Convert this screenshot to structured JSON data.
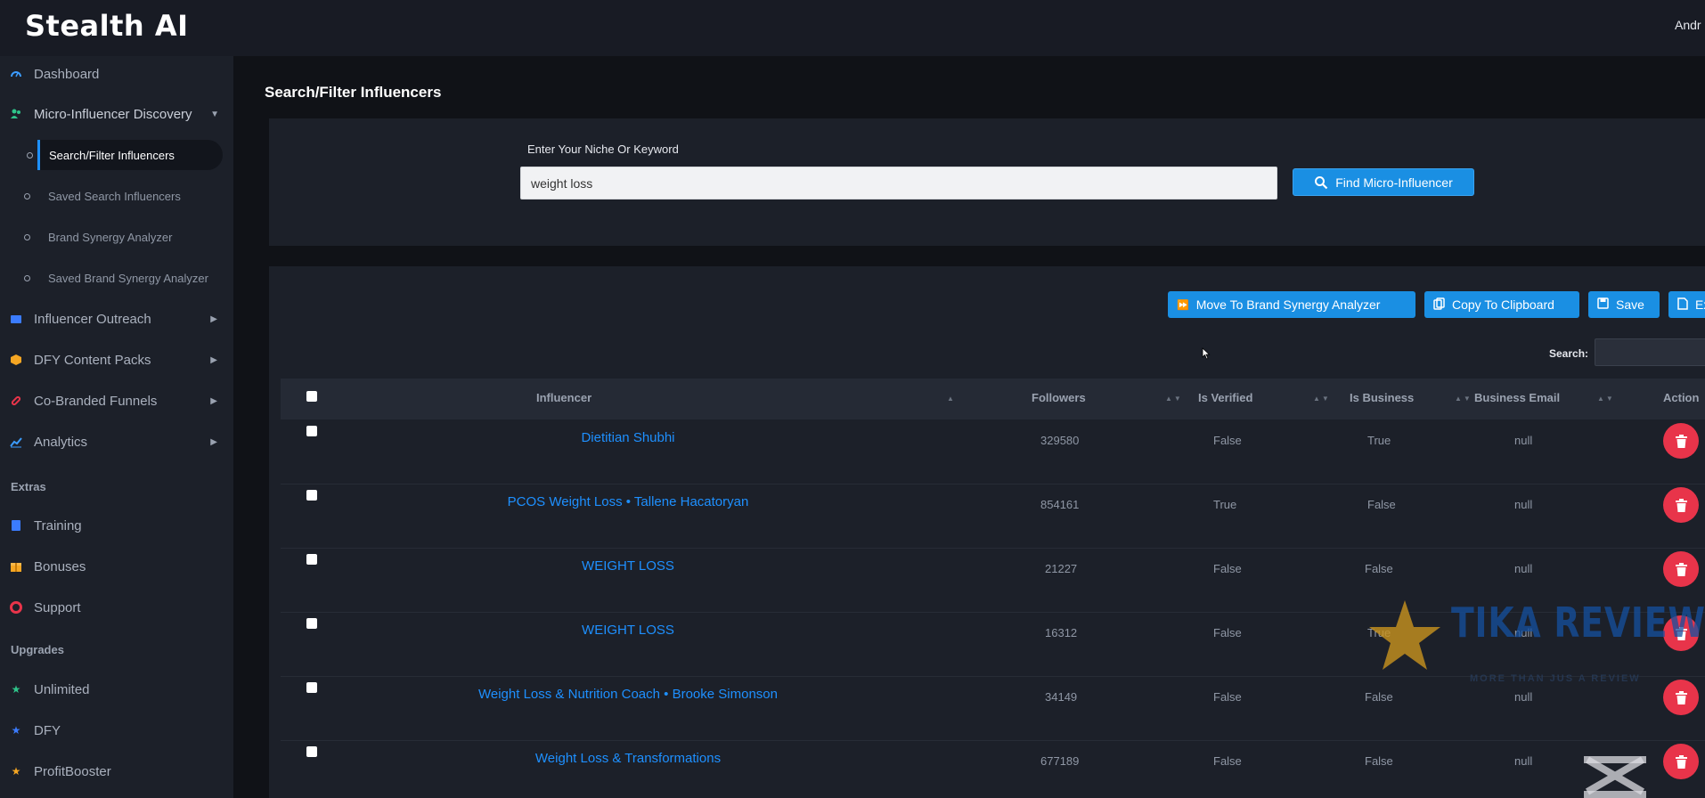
{
  "app": {
    "logo": "Stealth AI",
    "user": "Andr"
  },
  "colors": {
    "accent": "#1a8fe3",
    "danger": "#e8344a",
    "link": "#1e90ff"
  },
  "sidebar": {
    "items": [
      {
        "label": "Dashboard",
        "icon": "dashboard-icon"
      },
      {
        "label": "Micro-Influencer Discovery",
        "icon": "people-icon"
      },
      {
        "label": "Influencer Outreach",
        "icon": "envelope-icon"
      },
      {
        "label": "DFY Content Packs",
        "icon": "box-icon"
      },
      {
        "label": "Co-Branded Funnels",
        "icon": "link-icon"
      },
      {
        "label": "Analytics",
        "icon": "chart-icon"
      }
    ],
    "subitems": [
      "Search/Filter Influencers",
      "Saved Search Influencers",
      "Brand Synergy Analyzer",
      "Saved Brand Synergy Analyzer"
    ],
    "extras_heading": "Extras",
    "extras": [
      "Training",
      "Bonuses",
      "Support"
    ],
    "upgrades_heading": "Upgrades",
    "upgrades": [
      "Unlimited",
      "DFY",
      "ProfitBooster"
    ]
  },
  "main": {
    "title": "Search/Filter Influencers",
    "keyword_label": "Enter Your Niche Or Keyword",
    "keyword_value": "weight loss",
    "find_button": "Find Micro-Influencer"
  },
  "toolbar": {
    "move": "Move To Brand Synergy Analyzer",
    "copy": "Copy To Clipboard",
    "save": "Save",
    "export": "Export All To"
  },
  "table": {
    "search_label": "Search:",
    "columns": [
      "Influencer",
      "Followers",
      "Is Verified",
      "Is Business",
      "Business Email",
      "Action"
    ],
    "rows": [
      {
        "name": "Dietitian Shubhi",
        "followers": "329580",
        "verified": "False",
        "business": "True",
        "email": "null"
      },
      {
        "name": "PCOS Weight Loss • Tallene Hacatoryan",
        "followers": "854161",
        "verified": "True",
        "business": "False",
        "email": "null"
      },
      {
        "name": "WEIGHT LOSS",
        "followers": "21227",
        "verified": "False",
        "business": "False",
        "email": "null"
      },
      {
        "name": "WEIGHT LOSS",
        "followers": "16312",
        "verified": "False",
        "business": "True",
        "email": "null"
      },
      {
        "name": "Weight Loss & Nutrition Coach • Brooke Simonson",
        "followers": "34149",
        "verified": "False",
        "business": "False",
        "email": "null"
      },
      {
        "name": "Weight Loss & Transformations",
        "followers": "677189",
        "verified": "False",
        "business": "False",
        "email": "null"
      }
    ]
  },
  "watermark": {
    "title": "TIKA REVIEW",
    "subtitle": "MORE THAN JUS A REVIEW"
  }
}
